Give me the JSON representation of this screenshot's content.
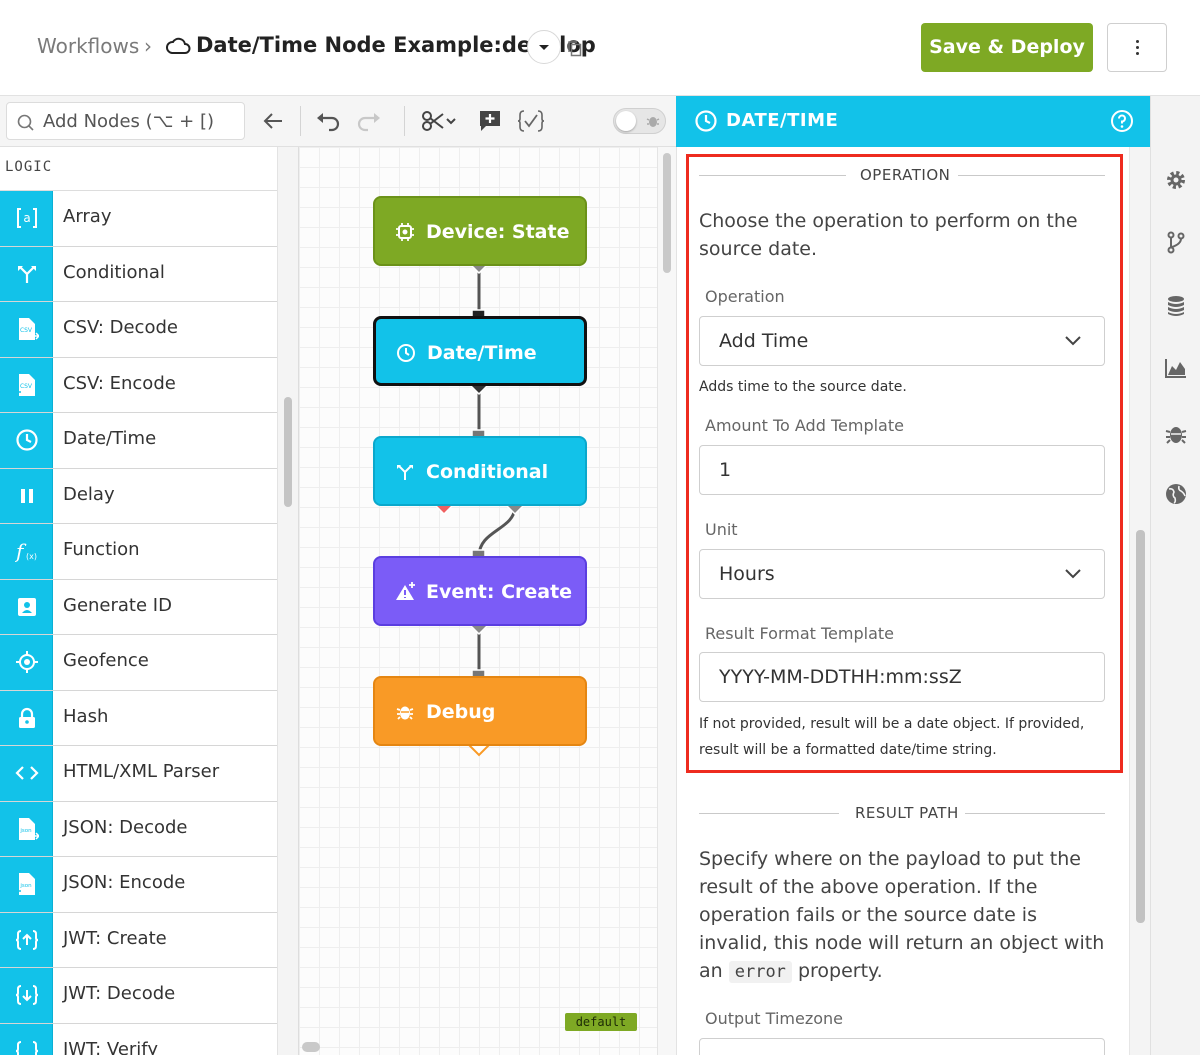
{
  "header": {
    "breadcrumb_root": "Workflows",
    "breadcrumb_sep": "›",
    "title": "Date/Time Node Example:develop",
    "save_label": "Save & Deploy"
  },
  "toolbar": {
    "search_placeholder": "Add Nodes (⌥ + [)"
  },
  "palette": {
    "category": "LOGIC",
    "items": [
      {
        "label": "Array",
        "icon": "array-icon"
      },
      {
        "label": "Conditional",
        "icon": "branch-icon"
      },
      {
        "label": "CSV: Decode",
        "icon": "csv-file-icon"
      },
      {
        "label": "CSV: Encode",
        "icon": "csv-file-icon"
      },
      {
        "label": "Date/Time",
        "icon": "clock-icon"
      },
      {
        "label": "Delay",
        "icon": "pause-icon"
      },
      {
        "label": "Function",
        "icon": "function-icon"
      },
      {
        "label": "Generate ID",
        "icon": "id-card-icon"
      },
      {
        "label": "Geofence",
        "icon": "crosshair-icon"
      },
      {
        "label": "Hash",
        "icon": "lock-icon"
      },
      {
        "label": "HTML/XML Parser",
        "icon": "code-brackets-icon"
      },
      {
        "label": "JSON: Decode",
        "icon": "json-file-icon"
      },
      {
        "label": "JSON: Encode",
        "icon": "json-file-icon"
      },
      {
        "label": "JWT: Create",
        "icon": "jwt-icon"
      },
      {
        "label": "JWT: Decode",
        "icon": "jwt-icon"
      },
      {
        "label": "JWT: Verify",
        "icon": "jwt-icon"
      }
    ]
  },
  "canvas": {
    "nodes": [
      {
        "label": "Device: State",
        "color": "#7ea924"
      },
      {
        "label": "Date/Time",
        "color": "#12c2e9"
      },
      {
        "label": "Conditional",
        "color": "#12c2e9"
      },
      {
        "label": "Event: Create",
        "color": "#7b5cf7"
      },
      {
        "label": "Debug",
        "color": "#f99a26"
      }
    ],
    "badge": "default"
  },
  "panel": {
    "title": "DATE/TIME",
    "operation_section": "OPERATION",
    "operation_desc": "Choose the operation to perform on the source date.",
    "operation_label": "Operation",
    "operation_value": "Add Time",
    "operation_hint": "Adds time to the source date.",
    "amount_label": "Amount To Add Template",
    "amount_value": "1",
    "unit_label": "Unit",
    "unit_value": "Hours",
    "format_label": "Result Format Template",
    "format_value": "YYYY-MM-DDTHH:mm:ssZ",
    "format_hint": "If not provided, result will be a date object. If provided, result will be a formatted date/time string.",
    "result_section": "RESULT PATH",
    "result_desc_pre": "Specify where on the payload to put the result of the above operation. If the operation fails or the source date is invalid, this node will return an object with an",
    "result_desc_code": "error",
    "result_desc_post": "property.",
    "timezone_label": "Output Timezone"
  },
  "colors": {
    "accent": "#12c2e9",
    "save": "#7ea924",
    "highlight": "#ee2b1f"
  }
}
